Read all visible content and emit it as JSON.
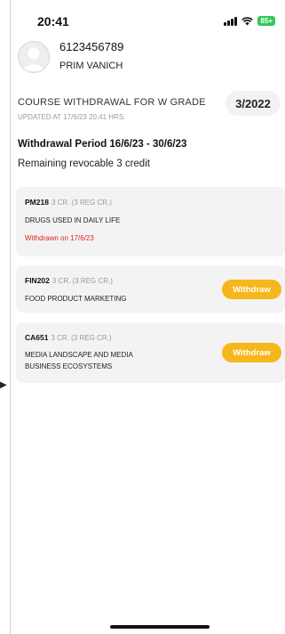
{
  "status_bar": {
    "time": "20:41",
    "battery": "85+"
  },
  "profile": {
    "student_id": "6123456789",
    "name": "PRIM VANICH"
  },
  "header": {
    "title": "COURSE WITHDRAWAL FOR W GRADE",
    "updated": "UPDATED AT 17/6/23 20:41 HRS.",
    "semester": "3/2022"
  },
  "period": {
    "label": "Withdrawal Period 16/6/23 - 30/6/23",
    "remaining": "Remaining revocable 3 credit"
  },
  "courses": [
    {
      "code": "PM218",
      "credit": "3 CR. (3 REG CR.)",
      "name": "DRUGS USED IN DAILY LIFE",
      "status": "Withdrawn on 17/6/23"
    },
    {
      "code": "FIN202",
      "credit": "3 CR. (3 REG CR.)",
      "name": "FOOD PRODUCT MARKETING",
      "action": "Withdraw"
    },
    {
      "code": "CA651",
      "credit": "3 CR. (3 REG CR.)",
      "name_line1": "MEDIA LANDSCAPE AND MEDIA",
      "name_line2": "BUSINESS ECOSYSTEMS",
      "action": "Withdraw"
    }
  ]
}
